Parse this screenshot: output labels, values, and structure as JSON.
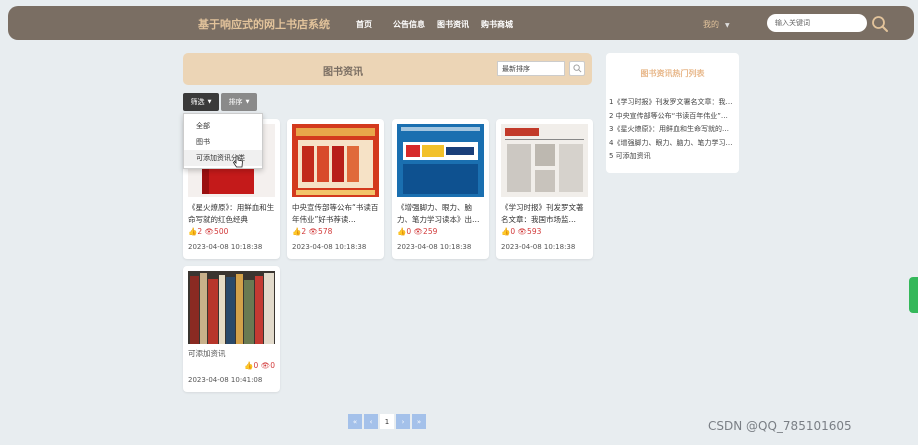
{
  "header": {
    "site_title": "基于响应式的网上书店系统",
    "nav": [
      "首页",
      "公告信息",
      "图书资讯",
      "购书商城"
    ],
    "user_menu": "我的",
    "search_placeholder": "输入关键词"
  },
  "news": {
    "title": "图书资讯",
    "sort_select": "最新排序",
    "filter_button": "筛选",
    "sort_button": "排序",
    "filter_options": [
      "全部",
      "图书",
      "可添加资讯分类"
    ]
  },
  "cards": [
    {
      "title": "《星火燎原》：用鲜血和生命写就的红色经典",
      "likes": "2",
      "views": "500",
      "date": "2023-04-08 10:18:38"
    },
    {
      "title": "中央宣传部等公布“书读百年伟业”好书荐读…",
      "likes": "2",
      "views": "578",
      "date": "2023-04-08 10:18:38"
    },
    {
      "title": "《增强脚力、眼力、脑力、笔力学习读本》出…",
      "likes": "0",
      "views": "259",
      "date": "2023-04-08 10:18:38"
    },
    {
      "title": "《学习时报》刊发罗文著名文章：我国市场监…",
      "likes": "0",
      "views": "593",
      "date": "2023-04-08 10:18:38"
    },
    {
      "title": "可添加资讯",
      "likes": "0",
      "views": "0",
      "date": "2023-04-08 10:41:08"
    }
  ],
  "hot": {
    "title": "图书资讯热门列表",
    "items": [
      "1《学习时报》刊发罗文署名文章：我…",
      "2 中央宣传部等公布“书读百年伟业”…",
      "3《星火燎原》：用鲜血和生命写就的…",
      "4《增强脚力、眼力、脑力、笔力学习…",
      "5 可添加资讯"
    ]
  },
  "pager": {
    "first": "«",
    "prev": "‹",
    "current": "1",
    "next": "›",
    "last": "»"
  },
  "watermark": "CSDN @QQ_785101605",
  "colors": {
    "header_bg": "#7a6e63",
    "accent": "#e2c39b",
    "news_header_bg": "#ecd5b6",
    "stats_red": "#d23a3a",
    "pager_blue": "#a4c1ea"
  },
  "icons": {
    "search": "search-icon",
    "like": "thumb-up-icon",
    "view": "eye-icon",
    "cursor": "hand-pointer-icon"
  }
}
